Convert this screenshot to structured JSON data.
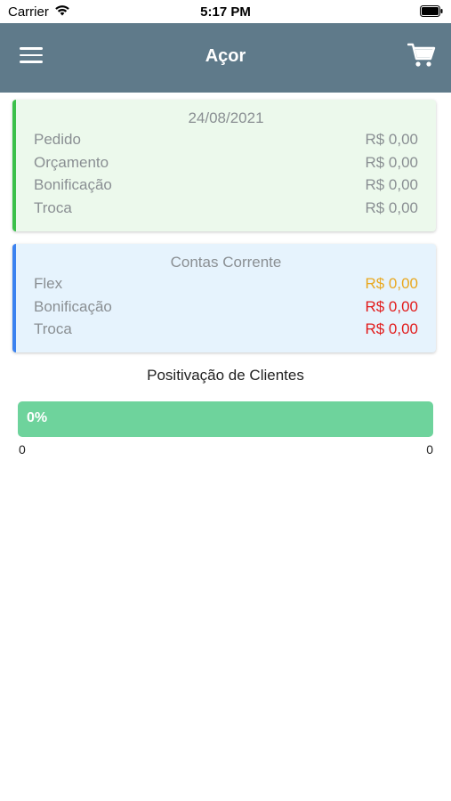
{
  "status_bar": {
    "carrier": "Carrier",
    "time": "5:17 PM",
    "icons": [
      "wifi-icon",
      "battery-icon"
    ]
  },
  "header": {
    "title": "Açor",
    "background_color": "#5f7a8a",
    "menu_icon": "hamburger-menu-icon",
    "cart_icon": "shopping-cart-icon"
  },
  "summary_card": {
    "date": "24/08/2021",
    "accent_color": "#3bc04a",
    "rows": [
      {
        "label": "Pedido",
        "value": "R$ 0,00"
      },
      {
        "label": "Orçamento",
        "value": "R$ 0,00"
      },
      {
        "label": "Bonificação",
        "value": "R$ 0,00"
      },
      {
        "label": "Troca",
        "value": "R$ 0,00"
      }
    ]
  },
  "accounts_card": {
    "title": "Contas Corrente",
    "accent_color": "#3b82f0",
    "rows": [
      {
        "label": "Flex",
        "value": "R$ 0,00",
        "value_color": "#e9a820"
      },
      {
        "label": "Bonificação",
        "value": "R$ 0,00",
        "value_color": "#e21b1b"
      },
      {
        "label": "Troca",
        "value": "R$ 0,00",
        "value_color": "#e21b1b"
      }
    ]
  },
  "positivacao": {
    "title": "Positivação de Clientes",
    "progress_label": "0%",
    "progress_fraction": 0.0,
    "min_label": "0",
    "max_label": "0",
    "bar_color": "#6ed39c"
  }
}
